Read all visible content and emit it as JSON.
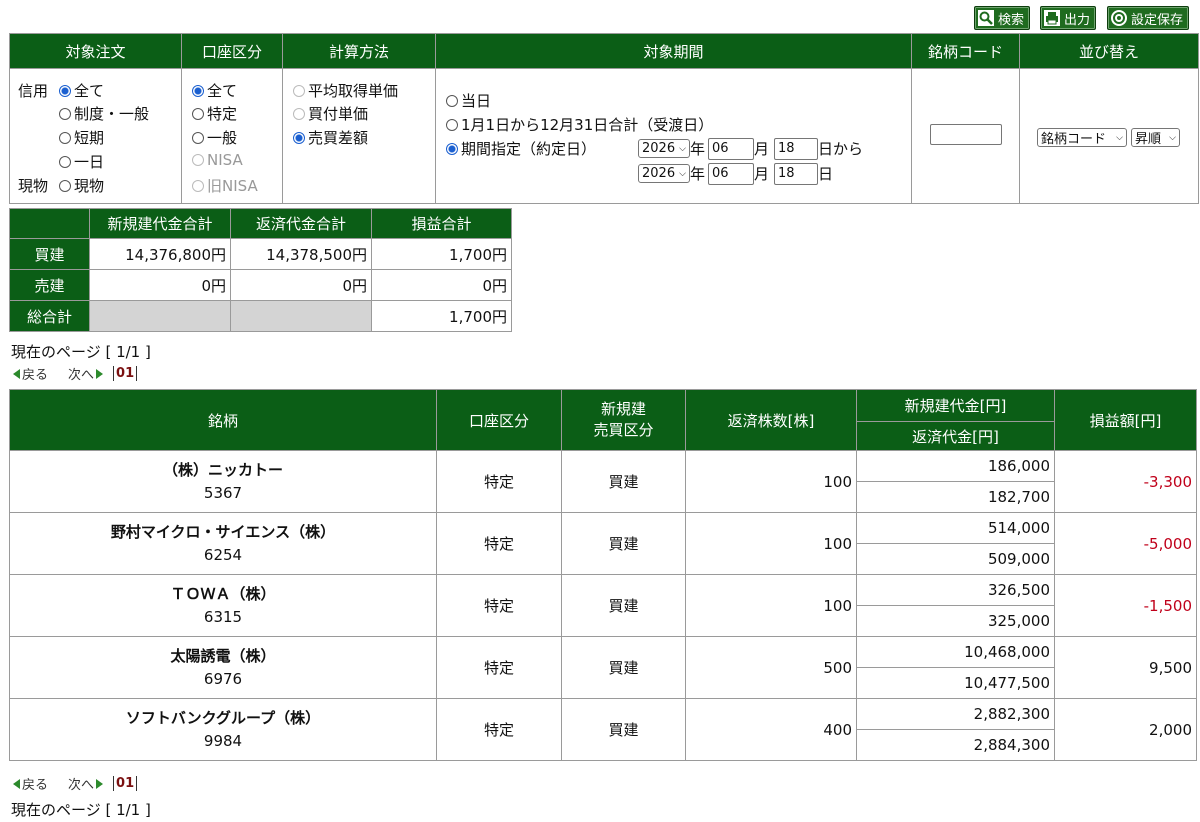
{
  "toolbar": {
    "search_label": "検索",
    "output_label": "出力",
    "save_label": "設定保存"
  },
  "filter": {
    "headers": {
      "target_order": "対象注文",
      "account": "口座区分",
      "calc": "計算方法",
      "period": "対象期間",
      "code": "銘柄コード",
      "sort": "並び替え"
    },
    "target_order": {
      "margin_label": "信用",
      "spot_label": "現物",
      "options": [
        "全て",
        "制度・一般",
        "短期",
        "一日",
        "現物"
      ]
    },
    "account": {
      "options": [
        "全て",
        "特定",
        "一般",
        "NISA",
        "旧NISA"
      ]
    },
    "calc": {
      "options": [
        "平均取得単価",
        "買付単価",
        "売買差額"
      ]
    },
    "period": {
      "options": [
        "当日",
        "1月1日から12月31日合計（受渡日）",
        "期間指定（約定日）"
      ],
      "from": {
        "year": "2026",
        "month": "06",
        "day": "18",
        "year_unit": "年",
        "month_unit": "月",
        "day_suffix": "日から"
      },
      "to": {
        "year": "2026",
        "month": "06",
        "day": "18",
        "year_unit": "年",
        "month_unit": "月",
        "day_suffix": "日"
      }
    },
    "code_value": "",
    "sort": {
      "key": "銘柄コード",
      "order": "昇順"
    }
  },
  "summary": {
    "headers": [
      "新規建代金合計",
      "返済代金合計",
      "損益合計"
    ],
    "rows": [
      {
        "label": "買建",
        "open": "14,376,800円",
        "close": "14,378,500円",
        "pl": "1,700円"
      },
      {
        "label": "売建",
        "open": "0円",
        "close": "0円",
        "pl": "0円"
      },
      {
        "label": "総合計",
        "open": "",
        "close": "",
        "pl": "1,700円"
      }
    ]
  },
  "pagination": {
    "current": "現在のページ [ 1/1 ]",
    "prev": "戻る",
    "next": "次へ",
    "page": "01"
  },
  "positions": {
    "headers": {
      "name": "銘柄",
      "account": "口座区分",
      "side_1": "新規建",
      "side_2": "売買区分",
      "qty": "返済株数[株]",
      "open": "新規建代金[円]",
      "close": "返済代金[円]",
      "pl": "損益額[円]"
    },
    "rows": [
      {
        "name": "（株）ニッカトー",
        "code": "5367",
        "account": "特定",
        "side": "買建",
        "qty": "100",
        "open": "186,000",
        "close": "182,700",
        "pl": "-3,300"
      },
      {
        "name": "野村マイクロ・サイエンス（株）",
        "code": "6254",
        "account": "特定",
        "side": "買建",
        "qty": "100",
        "open": "514,000",
        "close": "509,000",
        "pl": "-5,000"
      },
      {
        "name": "ＴＯＷＡ（株）",
        "code": "6315",
        "account": "特定",
        "side": "買建",
        "qty": "100",
        "open": "326,500",
        "close": "325,000",
        "pl": "-1,500"
      },
      {
        "name": "太陽誘電（株）",
        "code": "6976",
        "account": "特定",
        "side": "買建",
        "qty": "500",
        "open": "10,468,000",
        "close": "10,477,500",
        "pl": "9,500"
      },
      {
        "name": "ソフトバンクグループ（株）",
        "code": "9984",
        "account": "特定",
        "side": "買建",
        "qty": "400",
        "open": "2,882,300",
        "close": "2,884,300",
        "pl": "2,000"
      }
    ]
  },
  "colors": {
    "header_green": "#0b5e16",
    "loss_red": "#c0001a"
  }
}
